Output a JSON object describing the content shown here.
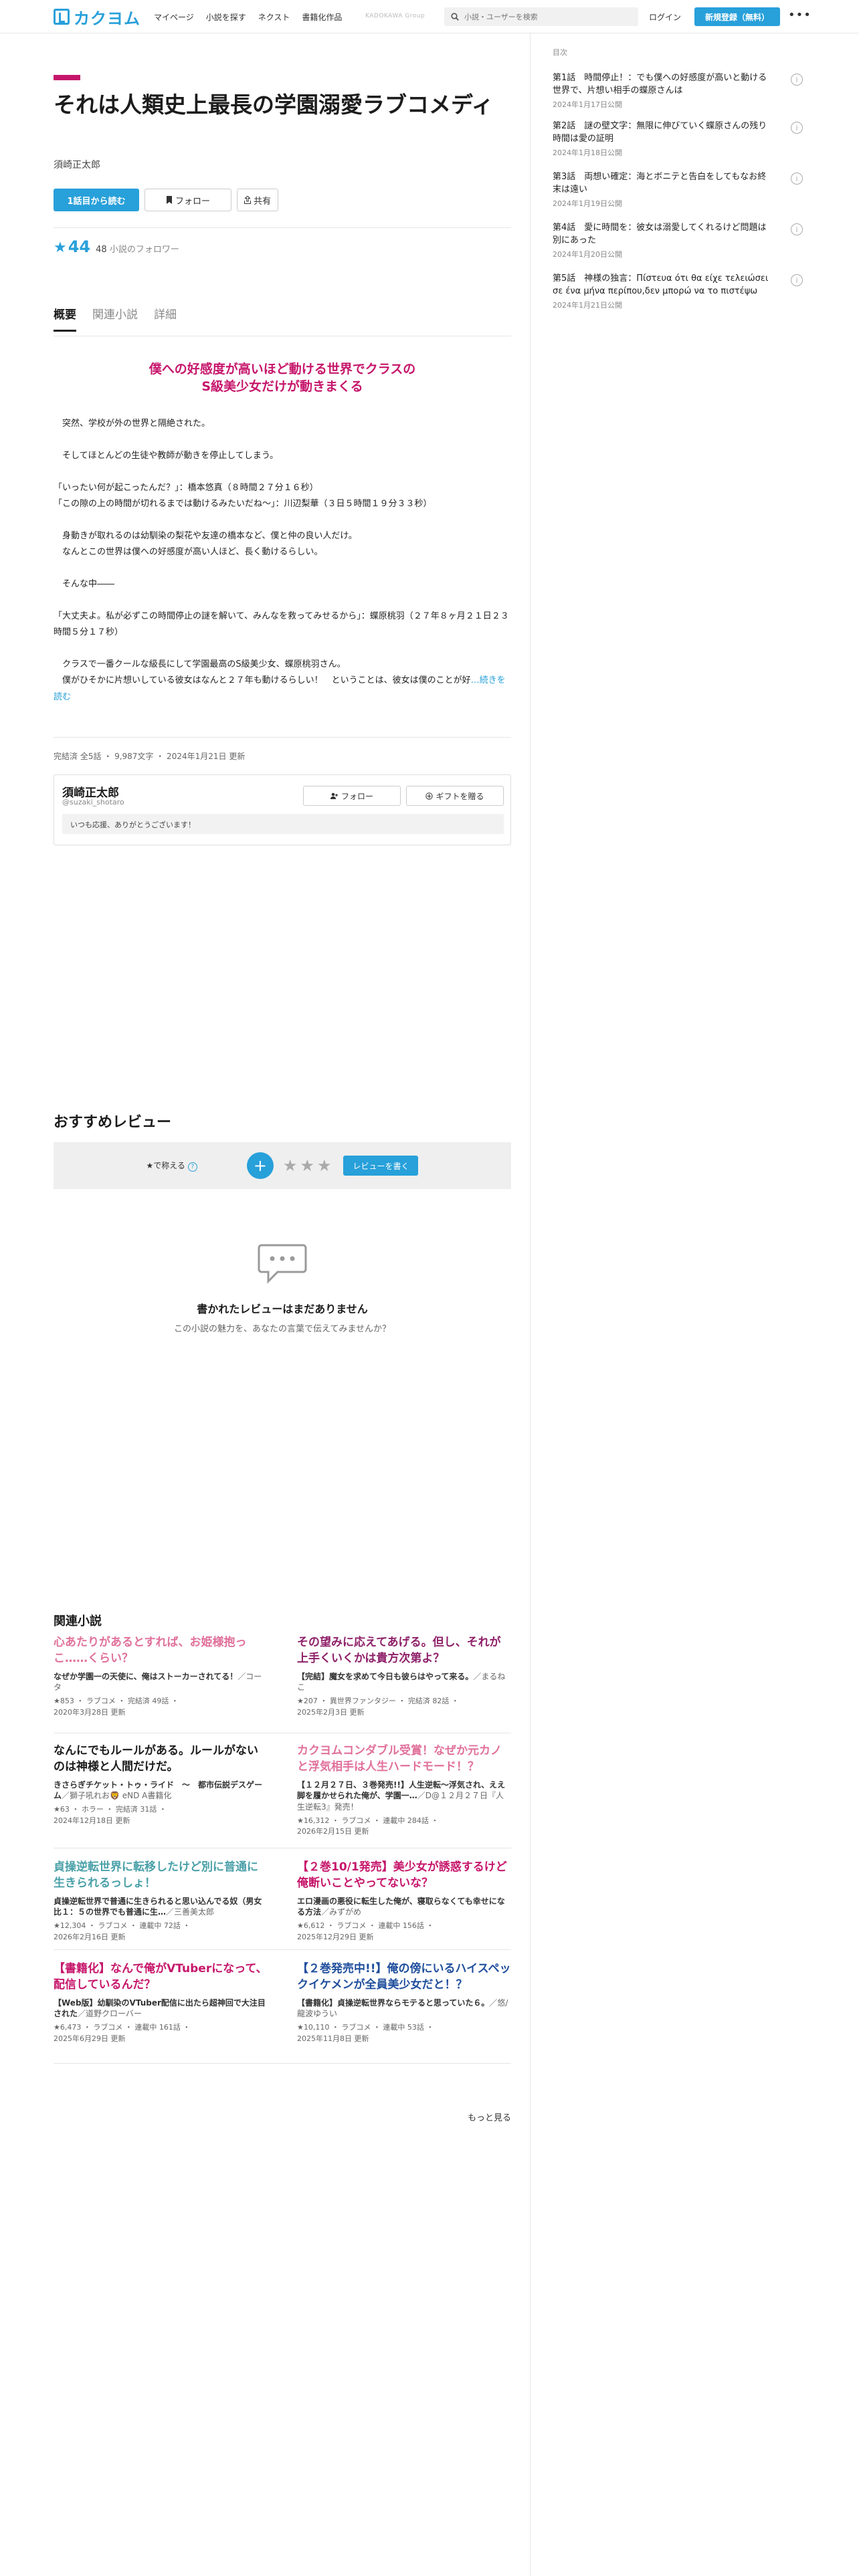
{
  "header": {
    "logo_text": "カクヨム",
    "nav": [
      "マイページ",
      "小説を探す",
      "ネクスト",
      "書籍化作品"
    ],
    "group_label": "KADOKAWA Group",
    "search_placeholder": "小説・ユーザーを検索",
    "login": "ログイン",
    "signup": "新規登録（無料）",
    "more": "•••"
  },
  "work": {
    "title": "それは人類史上最長の学園溺愛ラブコメディ",
    "author": "須崎正太郎",
    "read_button": "1話目から読む",
    "follow_button": "フォロー",
    "share_button": "共有",
    "rating": "44",
    "follower_count": "48",
    "follower_label": "小説のフォロワー"
  },
  "tabs": [
    "概要",
    "関連小説",
    "詳細"
  ],
  "catchcopy_line1": "僕への好感度が高いほど動ける世界でクラスの",
  "catchcopy_line2": "S級美少女だけが動きまくる",
  "intro": [
    "　突然、学校が外の世界と隔絶された。",
    "　そしてほとんどの生徒や教師が動きを停止してしまう。",
    "「いったい何が起こったんだ？」：橋本悠真（８時間２７分１６秒）\n「この隙の上の時間が切れるまでは動けるみたいだね～」：川辺梨華（３日５時間１９分３３秒）",
    "　身動きが取れるのは幼馴染の梨花や友達の橋本など、僕と仲の良い人だけ。\n　なんとこの世界は僕への好感度が高い人ほど、長く動けるらしい。",
    "　そんな中――",
    "「大丈夫よ。私が必ずこの時間停止の謎を解いて、みんなを救ってみせるから」：蝶原桃羽（２７年８ヶ月２１日２３時間５分１７秒）",
    "　クラスで一番クールな級長にして学園最高のS級美少女、蝶原桃羽さん。\n　僕がひそかに片想いしている彼女はなんと２７年も動けるらしい！　ということは、彼女は僕のことが好"
  ],
  "read_more": "…続きを読む",
  "stats": "完結済 全5話 ・ 9,987文字 ・ 2024年1月21日 更新",
  "author_box": {
    "name": "須崎正太郎",
    "id": "@suzaki_shotaro",
    "follow": "フォロー",
    "gift": "ギフトを贈る",
    "message": "いつも応援、ありがとうございます！"
  },
  "review": {
    "heading": "おすすめレビュー",
    "label": "★で称える",
    "help": "?",
    "plus": "+",
    "stars": "★★★",
    "write": "レビューを書く",
    "empty_title": "書かれたレビューはまだありません",
    "empty_sub": "この小説の魅力を、あなたの言葉で伝えてみませんか？"
  },
  "related": {
    "heading": "関連小説",
    "more": "もっと見る",
    "items": [
      {
        "title": "心あたりがあるとすれば、お姫様抱っこ……くらい？",
        "color": "#e0709a",
        "sub": "なぜか学園一の天使に、俺はストーカーされてる！",
        "by": "／コータ",
        "meta": "★853 ・ ラブコメ ・ 完結済 49話 ・\n2020年3月28日 更新"
      },
      {
        "title": "その望みに応えてあげる。但し、それが上手くいくかは貴方次第よ？",
        "color": "#8e2069",
        "sub": "【完結】魔女を求めて今日も彼らはやって来る。",
        "by": "／まるねこ",
        "meta": "★207 ・ 異世界ファンタジー ・ 完結済 82話 ・\n2025年2月3日 更新"
      },
      {
        "title": "なんにでもルールがある。ルールがないのは神様と人間だけだ。",
        "color": "#1c1c1c",
        "sub": "きさらぎチケット・トゥ・ライド　～　都市伝説デスゲーム",
        "by": "／獅子吼れお🦁 eND A書籍化",
        "meta": "★63 ・ ホラー ・ 完結済 31話 ・\n2024年12月18日 更新"
      },
      {
        "title": "カクヨムコンダブル受賞！なぜか元カノと浮気相手は人生ハードモード！？",
        "color": "#e0709a",
        "sub": "【１２月２７日、３巻発売!!】人生逆転〜浮気され、ええ脚を履かせられた俺が、学園一…",
        "by": "／D@１２月２７日『人生逆転3』発売！",
        "meta": "★16,312 ・ ラブコメ ・ 連載中 284話 ・\n2026年2月15日 更新"
      },
      {
        "title": "貞操逆転世界に転移したけど別に普通に生きられるっしょ！",
        "color": "#4aa0a8",
        "sub": "貞操逆転世界で普通に生きられると思い込んでる奴（男女比１：５の世界でも普通に生…",
        "by": "／三善美太郎",
        "meta": "★12,304 ・ ラブコメ ・ 連載中 72話 ・\n2026年2月16日 更新"
      },
      {
        "title": "【２巻10/1発売】美少女が誘惑するけど俺断いことやってないな？",
        "color": "#c6166b",
        "sub": "エロ漫画の悪役に転生した俺が、寝取らなくても幸せになる方法",
        "by": "／みずがめ",
        "meta": "★6,612 ・ ラブコメ ・ 連載中 156話 ・\n2025年12月29日 更新"
      },
      {
        "title": "【書籍化】なんで俺がVTuberになって、配信しているんだ？",
        "color": "#c6166b",
        "sub": "【Web版】幼馴染のVTuber配信に出たら超神回で大注目された",
        "by": "／道野クローバー",
        "meta": "★6,473 ・ ラブコメ ・ 連載中 161話 ・\n2025年6月29日 更新"
      },
      {
        "title": "【２巻発売中!!】俺の傍にいるハイスペックイケメンが全員美少女だと！？",
        "color": "#1f4e9c",
        "sub": "【書籍化】貞操逆転世界ならモテると思っていた６。",
        "by": "／悠/龍波ゆうい",
        "meta": "★10,110 ・ ラブコメ ・ 連載中 53話 ・\n2025年11月8日 更新"
      }
    ]
  },
  "toc": {
    "heading": "目次",
    "items": [
      {
        "title": "第1話　時間停止！：でも僕への好感度が高いと動ける世界で、片想い相手の蝶原さんは",
        "date": "2024年1月17日公開"
      },
      {
        "title": "第2話　謎の壁文字：無限に伸びていく蝶原さんの残り時間は愛の証明",
        "date": "2024年1月18日公開"
      },
      {
        "title": "第3話　両想い確定：海とボニテと告白をしてもなお終末は遠い",
        "date": "2024年1月19日公開"
      },
      {
        "title": "第4話　愛に時間を：彼女は溺愛してくれるけど問題は別にあった",
        "date": "2024年1月20日公開"
      },
      {
        "title": "第5話　神様の独言：Πίστευα ότι θα είχε τελειώσει σε ένα μήνα περίπου,δεν μπορώ να το πιστέψω",
        "date": "2024年1月21日公開"
      }
    ]
  },
  "colors": {
    "accent": "#28a0da",
    "brand_pink": "#c6166b"
  }
}
